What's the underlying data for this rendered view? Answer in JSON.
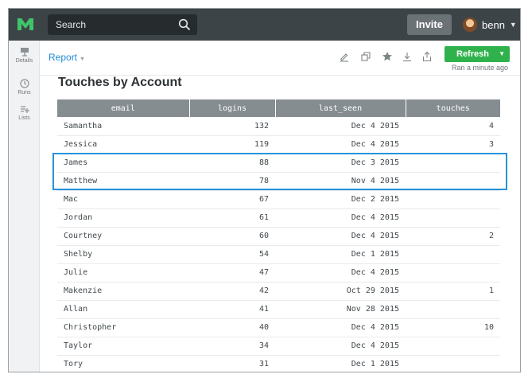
{
  "topbar": {
    "search_placeholder": "Search",
    "invite_label": "Invite",
    "user_name": "benn"
  },
  "sidebar": {
    "items": [
      {
        "label": "Details",
        "icon": "presentation-icon"
      },
      {
        "label": "Runs",
        "icon": "clock-icon"
      },
      {
        "label": "Lists",
        "icon": "list-add-icon"
      }
    ]
  },
  "report": {
    "breadcrumb": "Report",
    "refresh_label": "Refresh",
    "ran_status": "Ran a minute ago",
    "title": "Touches by Account",
    "toolbar_icons": [
      "edit-icon",
      "duplicate-icon",
      "star-icon",
      "download-icon",
      "share-icon"
    ]
  },
  "colors": {
    "accent": "#1c8bd6",
    "refresh": "#2fb24b",
    "highlight": "#2693d9",
    "header": "#858d91"
  },
  "table": {
    "columns": [
      "email",
      "logins",
      "last_seen",
      "touches"
    ],
    "rows": [
      {
        "email": "Samantha",
        "logins": "132",
        "last_seen": "Dec 4 2015",
        "touches": "4"
      },
      {
        "email": "Jessica",
        "logins": "119",
        "last_seen": "Dec 4 2015",
        "touches": "3"
      },
      {
        "email": "James",
        "logins": "88",
        "last_seen": "Dec 3 2015",
        "touches": ""
      },
      {
        "email": "Matthew",
        "logins": "78",
        "last_seen": "Nov 4 2015",
        "touches": ""
      },
      {
        "email": "Mac",
        "logins": "67",
        "last_seen": "Dec 2 2015",
        "touches": ""
      },
      {
        "email": "Jordan",
        "logins": "61",
        "last_seen": "Dec 4 2015",
        "touches": ""
      },
      {
        "email": "Courtney",
        "logins": "60",
        "last_seen": "Dec 4 2015",
        "touches": "2"
      },
      {
        "email": "Shelby",
        "logins": "54",
        "last_seen": "Dec 1 2015",
        "touches": ""
      },
      {
        "email": "Julie",
        "logins": "47",
        "last_seen": "Dec 4 2015",
        "touches": ""
      },
      {
        "email": "Makenzie",
        "logins": "42",
        "last_seen": "Oct 29 2015",
        "touches": "1"
      },
      {
        "email": "Allan",
        "logins": "41",
        "last_seen": "Nov 28 2015",
        "touches": ""
      },
      {
        "email": "Christopher",
        "logins": "40",
        "last_seen": "Dec 4 2015",
        "touches": "10"
      },
      {
        "email": "Taylor",
        "logins": "34",
        "last_seen": "Dec 4 2015",
        "touches": ""
      },
      {
        "email": "Tory",
        "logins": "31",
        "last_seen": "Dec 1 2015",
        "touches": ""
      }
    ],
    "highlighted_rows": [
      "James",
      "Matthew"
    ]
  }
}
